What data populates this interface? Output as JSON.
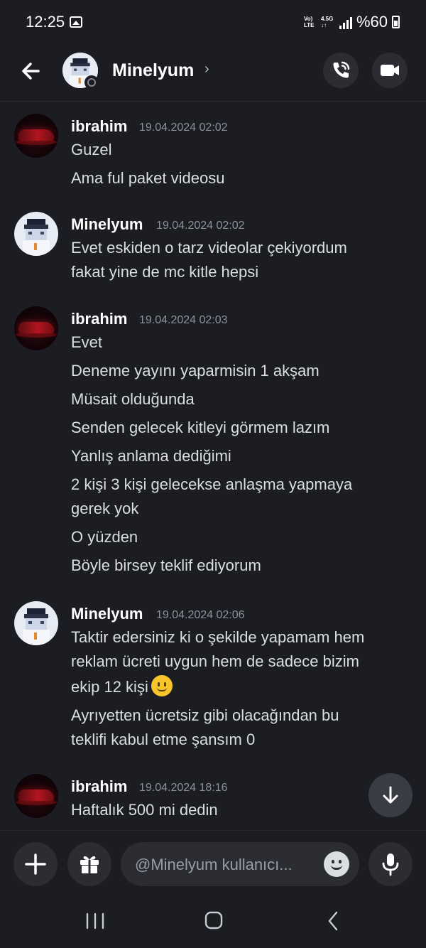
{
  "status_bar": {
    "time": "12:25",
    "net_volte": "Vo)\nLTE",
    "net_4g": "4.5G\n↓↑",
    "battery": "%60"
  },
  "header": {
    "name": "Minelyum",
    "chevron": "›"
  },
  "messages": [
    {
      "author": "ibrahim",
      "time": "19.04.2024 02:02",
      "avatar": "car-avatar",
      "lines": [
        "Guzel",
        "Ama ful paket videosu"
      ]
    },
    {
      "author": "Minelyum",
      "time": "19.04.2024 02:02",
      "avatar": "pixel-avatar",
      "lines": [
        "Evet eskiden o tarz videolar çekiyordum",
        "fakat yine de mc kitle hepsi"
      ]
    },
    {
      "author": "ibrahim",
      "time": "19.04.2024 02:03",
      "avatar": "car-avatar",
      "lines": [
        "Evet",
        "Deneme yayını yaparmisin 1 akşam",
        "Müsait olduğunda",
        "Senden gelecek kitleyi görmem lazım",
        "Yanlış anlama dediğimi",
        "2 kişi 3 kişi gelecekse anlaşma yapmaya",
        "gerek yok",
        "O yüzden",
        "Böyle birsey teklif ediyorum"
      ]
    },
    {
      "author": "Minelyum",
      "time": "19.04.2024 02:06",
      "avatar": "pixel-avatar",
      "lines": [
        "Taktir edersiniz ki o şekilde yapamam hem",
        "reklam ücreti uygun hem de sadece bizim",
        "ekip 12 kişi",
        "Ayrıyetten ücretsiz gibi olacağından bu",
        "teklifi kabul etme şansım 0"
      ],
      "emoji_after_line": "slightly-smiling-face"
    },
    {
      "author": "ibrahim",
      "time": "19.04.2024 18:16",
      "avatar": "car-avatar",
      "lines": [
        "Haftalık 500 mi dedin"
      ]
    }
  ],
  "composer": {
    "placeholder": "@Minelyum kullanıcı..."
  },
  "icons": {
    "back": "arrow-left-icon",
    "call": "phone-call-icon",
    "video": "video-camera-icon",
    "scroll": "arrow-down-icon",
    "plus": "plus-icon",
    "gift": "gift-icon",
    "emoji": "emoji-icon",
    "mic": "microphone-icon",
    "nav_recents": "recents-icon",
    "nav_home": "home-icon",
    "nav_back": "nav-back-icon"
  },
  "colors": {
    "background": "#1c1d22",
    "surface": "#2b2d33",
    "text_primary": "#f2f3f5",
    "text_secondary": "#8e9199"
  }
}
